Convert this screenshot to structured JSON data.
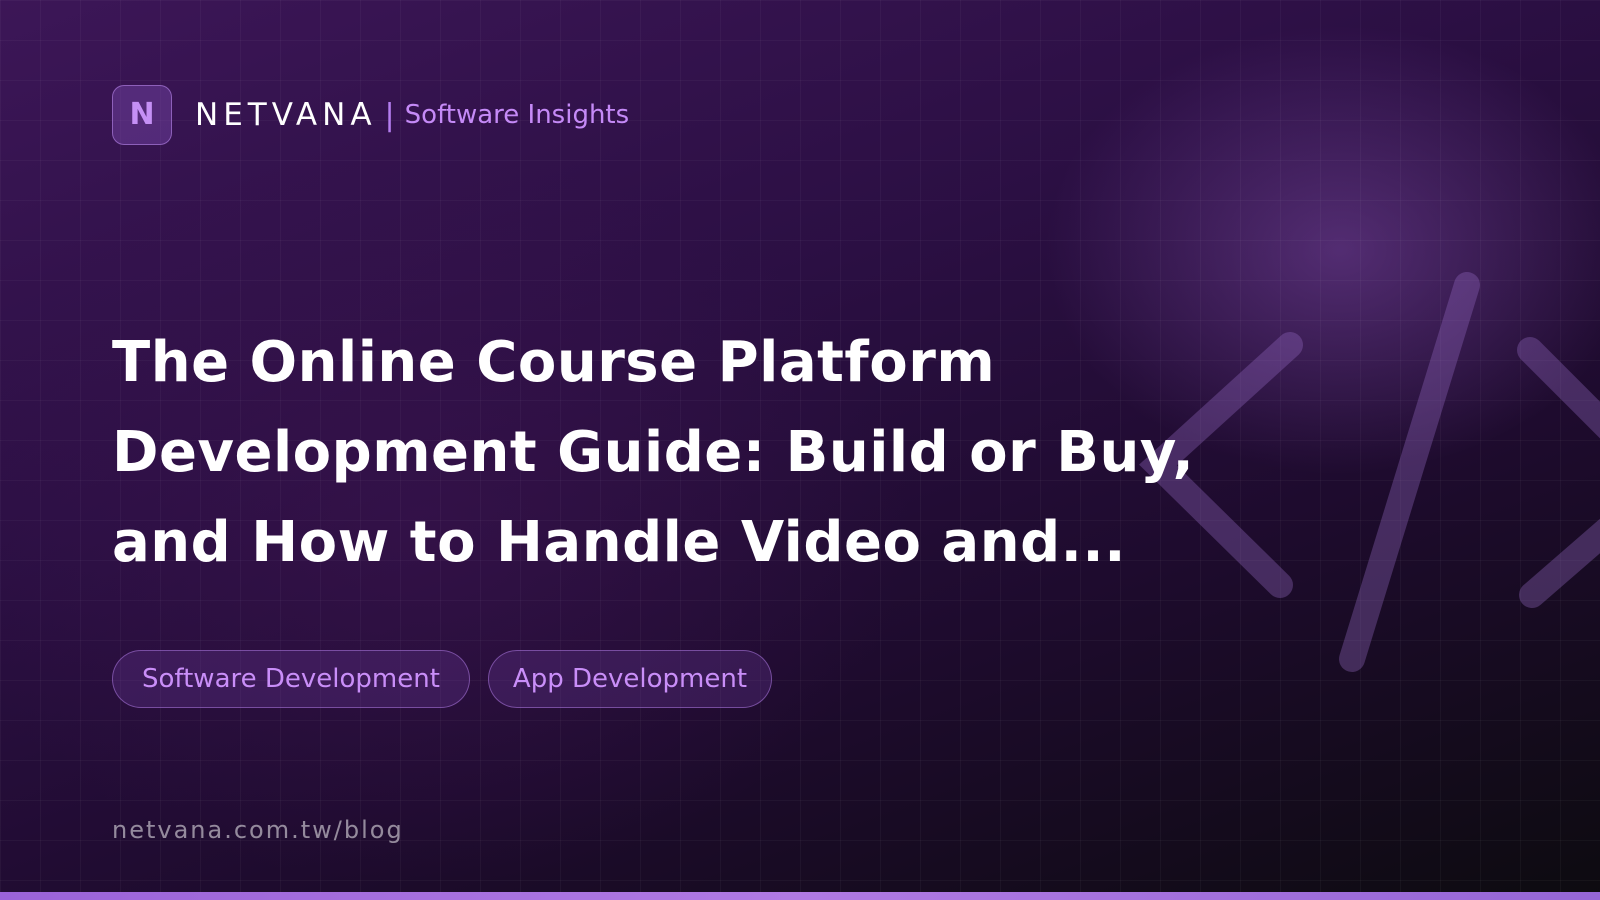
{
  "header": {
    "logo_letter": "N",
    "brand": "NETVANA",
    "separator": "|",
    "tagline": "Software Insights"
  },
  "title_lines": [
    "The Online Course Platform",
    "Development Guide: Build or Buy,",
    "and How to Handle Video and..."
  ],
  "tags": [
    "Software Development",
    "App Development"
  ],
  "footer": {
    "url": "netvana.com.tw/blog"
  },
  "decor": {
    "icon": "code-brackets-icon"
  },
  "colors": {
    "accent": "#c58af7",
    "background_start": "#3c1657",
    "background_end": "#0d0b10",
    "bottom_bar": "#9a63d8"
  }
}
